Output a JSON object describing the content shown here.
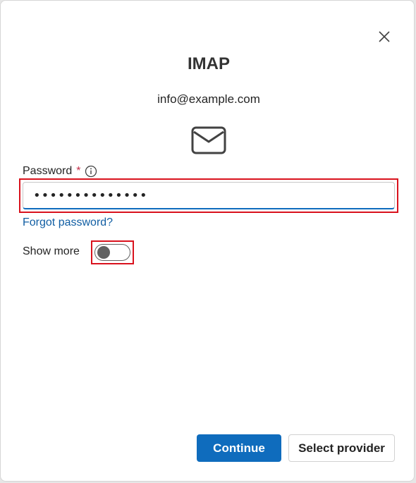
{
  "dialog": {
    "title": "IMAP",
    "email": "info@example.com"
  },
  "password": {
    "label": "Password",
    "required_marker": "*",
    "value": "••••••••••••••",
    "forgot_link": "Forgot password?"
  },
  "show_more": {
    "label": "Show more",
    "toggle_on": false
  },
  "buttons": {
    "continue": "Continue",
    "select_provider": "Select provider"
  },
  "icons": {
    "close": "close-icon",
    "mail": "mail-icon",
    "info": "info-icon"
  },
  "colors": {
    "accent": "#0f6cbd",
    "link": "#115ea3",
    "required": "#c4314b",
    "highlight": "#d9121d"
  }
}
